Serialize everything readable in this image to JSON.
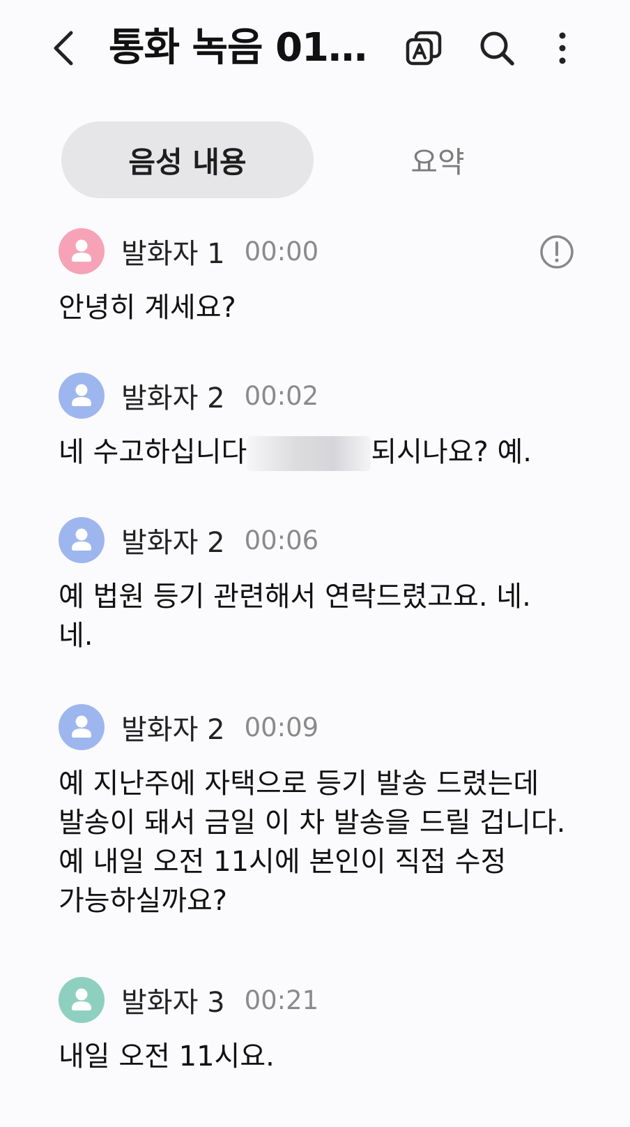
{
  "header": {
    "title": "통화 녹음 01…",
    "back_icon": "chevron-left-icon",
    "translate_icon": "translate-icon",
    "search_icon": "search-icon",
    "more_icon": "more-vertical-icon"
  },
  "tabs": [
    {
      "label": "음성 내용",
      "active": true
    },
    {
      "label": "요약",
      "active": false
    }
  ],
  "colors": {
    "speaker1": "#f6a3b7",
    "speaker2": "#9eb6ee",
    "speaker3": "#8ed0bf",
    "tab_active_bg": "#e6e6e8"
  },
  "transcript": [
    {
      "speaker": "발화자 1",
      "time": "00:00",
      "lines": [
        "안녕히 계세요?"
      ]
    },
    {
      "speaker": "발화자 2",
      "time": "00:02",
      "text_before": "네 수고하십니다",
      "text_after": "되시나요?  예."
    },
    {
      "speaker": "발화자 2",
      "time": "00:06",
      "lines": [
        "예 법원 등기 관련해서 연락드렸고요. 네.",
        "네."
      ]
    },
    {
      "speaker": "발화자 2",
      "time": "00:09",
      "lines": [
        "예 지난주에 자택으로 등기 발송 드렸는데",
        "발송이 돼서 금일 이 차 발송을 드릴 겁니다.",
        "예 내일 오전 11시에 본인이 직접 수정",
        "가능하실까요?"
      ]
    },
    {
      "speaker": "발화자 3",
      "time": "00:21",
      "lines": [
        "내일 오전 11시요."
      ]
    }
  ]
}
